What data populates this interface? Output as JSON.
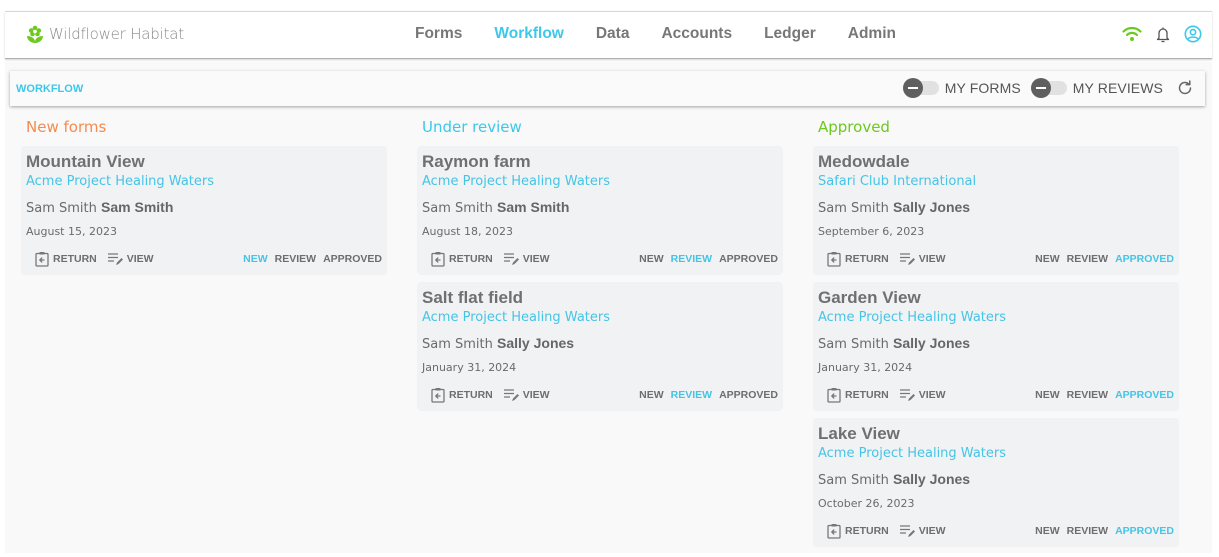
{
  "app": {
    "brand": "Wildflower Habitat",
    "colors": {
      "accent": "#3cc8ea",
      "new": "#f68b4f",
      "review": "#3cc8ea",
      "approved": "#6cc91e",
      "brand_icon": "#6cc91e"
    }
  },
  "nav": {
    "items": [
      {
        "label": "Forms",
        "active": false
      },
      {
        "label": "Workflow",
        "active": true
      },
      {
        "label": "Data",
        "active": false
      },
      {
        "label": "Accounts",
        "active": false
      },
      {
        "label": "Ledger",
        "active": false
      },
      {
        "label": "Admin",
        "active": false
      }
    ],
    "icons": [
      "wifi-icon",
      "bell-icon",
      "account-icon"
    ]
  },
  "subbar": {
    "title": "WORKFLOW",
    "toggles": [
      {
        "label": "MY FORMS",
        "on": false
      },
      {
        "label": "MY REVIEWS",
        "on": false
      }
    ],
    "refresh_icon": "refresh-icon"
  },
  "card_labels": {
    "return": "RETURN",
    "view": "VIEW",
    "status_new": "NEW",
    "status_review": "REVIEW",
    "status_approved": "APPROVED"
  },
  "columns": [
    {
      "title": "New forms",
      "cards": [
        {
          "title": "Mountain View",
          "org": "Acme Project Healing Waters",
          "owner": "Sam Smith",
          "reviewer": "Sam Smith",
          "date": "August 15, 2023",
          "status": "new"
        }
      ]
    },
    {
      "title": "Under review",
      "cards": [
        {
          "title": "Raymon farm",
          "org": "Acme Project Healing Waters",
          "owner": "Sam Smith",
          "reviewer": "Sam Smith",
          "date": "August 18, 2023",
          "status": "review"
        },
        {
          "title": "Salt flat field",
          "org": "Acme Project Healing Waters",
          "owner": "Sam Smith",
          "reviewer": "Sally Jones",
          "date": "January 31, 2024",
          "status": "review"
        }
      ]
    },
    {
      "title": "Approved",
      "cards": [
        {
          "title": "Medowdale",
          "org": "Safari Club International",
          "owner": "Sam Smith",
          "reviewer": "Sally Jones",
          "date": "September 6, 2023",
          "status": "approved"
        },
        {
          "title": "Garden View",
          "org": "Acme Project Healing Waters",
          "owner": "Sam Smith",
          "reviewer": "Sally Jones",
          "date": "January 31, 2024",
          "status": "approved"
        },
        {
          "title": "Lake View",
          "org": "Acme Project Healing Waters",
          "owner": "Sam Smith",
          "reviewer": "Sally Jones",
          "date": "October 26, 2023",
          "status": "approved"
        }
      ]
    }
  ]
}
